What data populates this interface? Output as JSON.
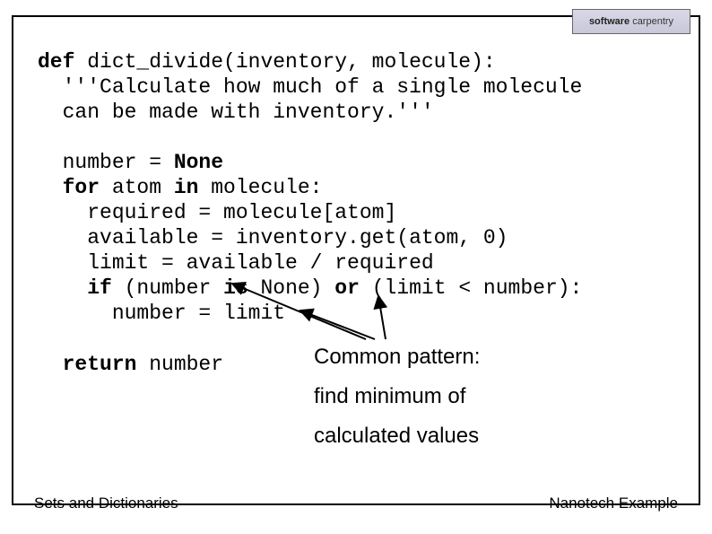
{
  "logo": {
    "bold": "software",
    "normal": "carpentry"
  },
  "code": {
    "l1_def": "def",
    "l1_rest": " dict_divide(inventory, molecule):",
    "l2": "  '''Calculate how much of a single molecule",
    "l3": "  can be made with inventory.'''",
    "l4": "",
    "l5a": "  number = ",
    "l5_none": "None",
    "l6_for": "  for",
    "l6_mid": " atom ",
    "l6_in": "in",
    "l6_rest": " molecule:",
    "l7": "    required = molecule[atom]",
    "l8": "    available = inventory.get(atom, 0)",
    "l9": "    limit = available / required",
    "l10_if": "    if",
    "l10_mid1": " (number ",
    "l10_is": "is",
    "l10_mid2": " None) ",
    "l10_or": "or",
    "l10_rest": " (limit < number):",
    "l11": "      number = limit",
    "l12": "",
    "l13_ret": "  return",
    "l13_rest": " number"
  },
  "annotation": {
    "line1": "Common pattern:",
    "line2": "find minimum of",
    "line3": "calculated values"
  },
  "footer": {
    "left": "Sets and Dictionaries",
    "right": "Nanotech Example"
  }
}
